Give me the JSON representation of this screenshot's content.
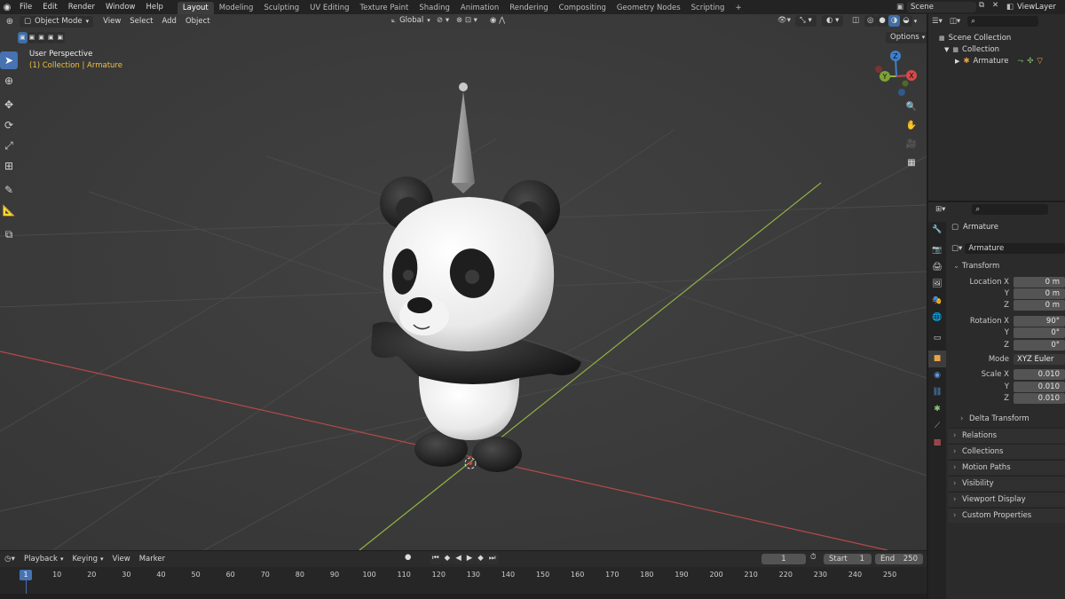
{
  "topbar": {
    "menus": [
      "File",
      "Edit",
      "Render",
      "Window",
      "Help"
    ],
    "workspaces": [
      "Layout",
      "Modeling",
      "Sculpting",
      "UV Editing",
      "Texture Paint",
      "Shading",
      "Animation",
      "Rendering",
      "Compositing",
      "Geometry Nodes",
      "Scripting"
    ],
    "active_workspace": "Layout",
    "add_tab": "+",
    "scene": "Scene",
    "view_layer": "ViewLayer"
  },
  "viewport": {
    "mode": "Object Mode",
    "menus": [
      "View",
      "Select",
      "Add",
      "Object"
    ],
    "orientation": "Global",
    "options": "Options",
    "perspective": "User Perspective",
    "collection_path": "(1) Collection | Armature",
    "gizmo": {
      "x": "X",
      "y": "Y",
      "z": "Z"
    }
  },
  "outliner": {
    "scene_collection": "Scene Collection",
    "collection": "Collection",
    "object": "Armature"
  },
  "properties": {
    "object_name": "Armature",
    "object_field": "Armature",
    "transform": {
      "title": "Transform",
      "location_label": "Location X",
      "rotation_label": "Rotation X",
      "scale_label": "Scale X",
      "y_label": "Y",
      "z_label": "Z",
      "mode_label": "Mode",
      "location": [
        "0 m",
        "0 m",
        "0 m"
      ],
      "rotation": [
        "90°",
        "0°",
        "0°"
      ],
      "mode": "XYZ Euler",
      "scale": [
        "0.010",
        "0.010",
        "0.010"
      ]
    },
    "subsections": [
      "Delta Transform"
    ],
    "sections": [
      "Relations",
      "Collections",
      "Motion Paths",
      "Visibility",
      "Viewport Display",
      "Custom Properties"
    ]
  },
  "timeline": {
    "menus": [
      "Playback",
      "Keying",
      "View",
      "Marker"
    ],
    "current_frame": "1",
    "start_label": "Start",
    "start": "1",
    "end_label": "End",
    "end": "250",
    "ruler": [
      "1",
      "10",
      "20",
      "30",
      "40",
      "50",
      "60",
      "70",
      "80",
      "90",
      "100",
      "110",
      "120",
      "130",
      "140",
      "150",
      "160",
      "170",
      "180",
      "190",
      "200",
      "210",
      "220",
      "230",
      "240",
      "250"
    ]
  },
  "colors": {
    "accent": "#4772b3",
    "x_axis": "#b54a4a",
    "y_axis": "#8fb341",
    "z_axis": "#3f7fcf",
    "selection_text": "#f0c040"
  }
}
